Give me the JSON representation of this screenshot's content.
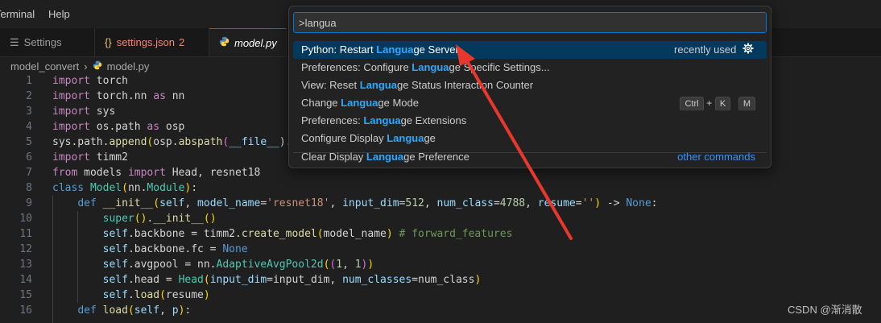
{
  "menu": {
    "terminal": "Terminal",
    "help": "Help"
  },
  "tabs": {
    "settings": {
      "icon": "☰",
      "label": "Settings"
    },
    "json": {
      "icon": "{}",
      "label": "settings.json",
      "badge": "2"
    },
    "model": {
      "label": "model.py"
    }
  },
  "breadcrumb": {
    "folder": "model_convert",
    "sep": "›",
    "file": "model.py"
  },
  "palette": {
    "query": ">langua",
    "items": [
      {
        "pre": "Python: Restart ",
        "hl": "Langua",
        "post": "ge Server",
        "right": "recently used"
      },
      {
        "pre": "Preferences: Configure ",
        "hl": "Langua",
        "post": "ge Specific Settings..."
      },
      {
        "pre": "View: Reset ",
        "hl": "Langua",
        "post": "ge Status Interaction Counter"
      },
      {
        "pre": "Change ",
        "hl": "Langua",
        "post": "ge Mode",
        "keys": [
          "Ctrl",
          "+",
          "K",
          "M"
        ]
      },
      {
        "pre": "Preferences: ",
        "hl": "Langua",
        "post": "ge Extensions"
      },
      {
        "pre": "Configure Display ",
        "hl": "Langua",
        "post": "ge"
      },
      {
        "pre": "Clear Display ",
        "hl": "Langua",
        "post": "ge Preference",
        "link": "other commands"
      }
    ]
  },
  "code": {
    "line_numbers": [
      "1",
      "2",
      "3",
      "4",
      "5",
      "6",
      "7",
      "8",
      "9",
      "10",
      "11",
      "12",
      "13",
      "14",
      "15",
      "16"
    ]
  },
  "watermark": "CSDN @渐消散",
  "colors": {
    "accent": "#0078d4",
    "selection": "#04395e",
    "highlight": "#2aaaff",
    "annotation_arrow": "#e8382e"
  }
}
